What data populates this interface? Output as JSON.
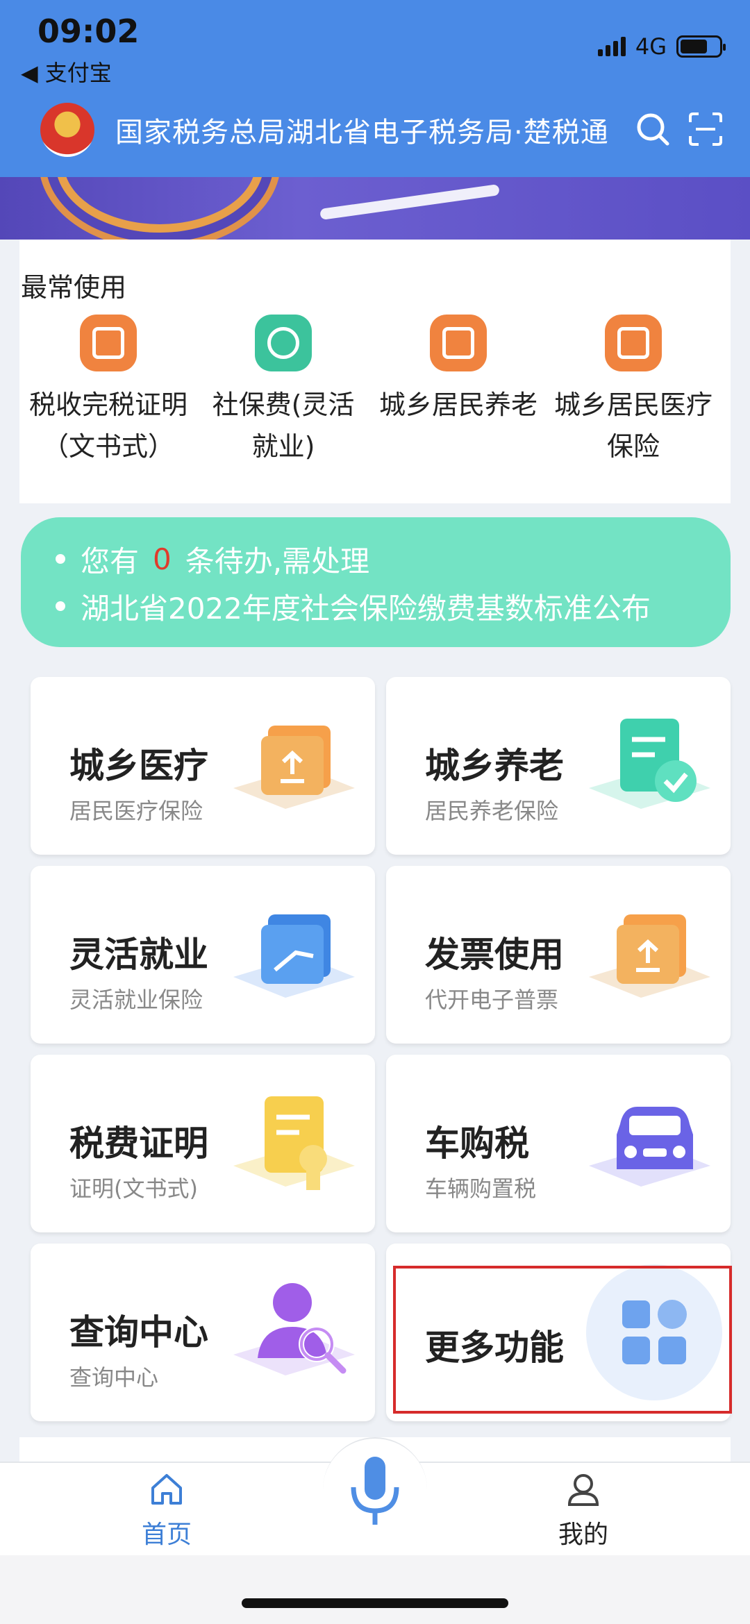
{
  "status": {
    "time": "09:02",
    "back_app": "◀ 支付宝",
    "network": "4G"
  },
  "header": {
    "title": "国家税务总局湖北省电子税务局·楚税通",
    "icons": [
      "search-icon",
      "scan-icon"
    ]
  },
  "frequent": {
    "title": "最常使用",
    "items": [
      {
        "label": "税收完税证明（文书式）",
        "icon": "certificate-icon",
        "color": "#f0833f"
      },
      {
        "label": "社保费(灵活就业)",
        "icon": "social-security-icon",
        "color": "#3cc39c"
      },
      {
        "label": "城乡居民养老",
        "icon": "pension-icon",
        "color": "#f0833f"
      },
      {
        "label": "城乡居民医疗保险",
        "icon": "medical-insurance-icon",
        "color": "#f0833f"
      }
    ]
  },
  "notice": {
    "prefix": "您有",
    "count": "0",
    "suffix": "条待办,需处理",
    "announcement": "湖北省2022年度社会保险缴费基数标准公布"
  },
  "cards": [
    {
      "title": "城乡医疗",
      "subtitle": "居民医疗保险"
    },
    {
      "title": "城乡养老",
      "subtitle": "居民养老保险"
    },
    {
      "title": "灵活就业",
      "subtitle": "灵活就业保险"
    },
    {
      "title": "发票使用",
      "subtitle": "代开电子普票"
    },
    {
      "title": "税费证明",
      "subtitle": "证明(文书式)"
    },
    {
      "title": "车购税",
      "subtitle": "车辆购置税"
    },
    {
      "title": "查询中心",
      "subtitle": "查询中心"
    },
    {
      "title": "更多功能",
      "subtitle": ""
    }
  ],
  "tabbar": {
    "home": "首页",
    "mine": "我的"
  },
  "colors": {
    "header": "#4a8ae6",
    "notice": "#73e3c4",
    "accent": "#3d7fd6",
    "highlight": "#d62b2b"
  }
}
